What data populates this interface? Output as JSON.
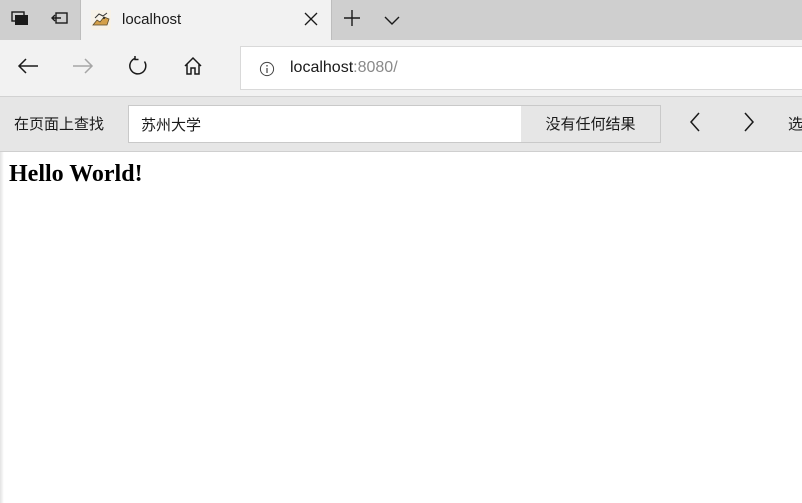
{
  "tab": {
    "title": "localhost",
    "favicon": "tomcat-favicon-icon",
    "close_icon": "close-icon"
  },
  "tab_controls": {
    "set_aside_icon": "tabs-aside-icon",
    "restore_icon": "show-set-aside-tabs-icon",
    "new_tab_icon": "plus-icon",
    "tab_list_icon": "chevron-down-icon"
  },
  "nav": {
    "back_icon": "arrow-left-icon",
    "forward_icon": "arrow-right-icon",
    "refresh_icon": "refresh-icon",
    "home_icon": "home-icon",
    "info_icon": "info-icon"
  },
  "address": {
    "host": "localhost",
    "rest": ":8080/"
  },
  "find": {
    "label": "在页面上查找",
    "query": "苏州大学",
    "result": "没有任何结果",
    "prev_icon": "chevron-left-icon",
    "next_icon": "chevron-right-icon",
    "options_label": "选"
  },
  "page": {
    "heading": "Hello World!"
  },
  "colors": {
    "tabstrip_bg": "#cfcfcf",
    "toolbar_bg": "#f2f2f2",
    "findbar_bg": "#e6e6e6",
    "disabled_icon": "#a6a6a6"
  }
}
